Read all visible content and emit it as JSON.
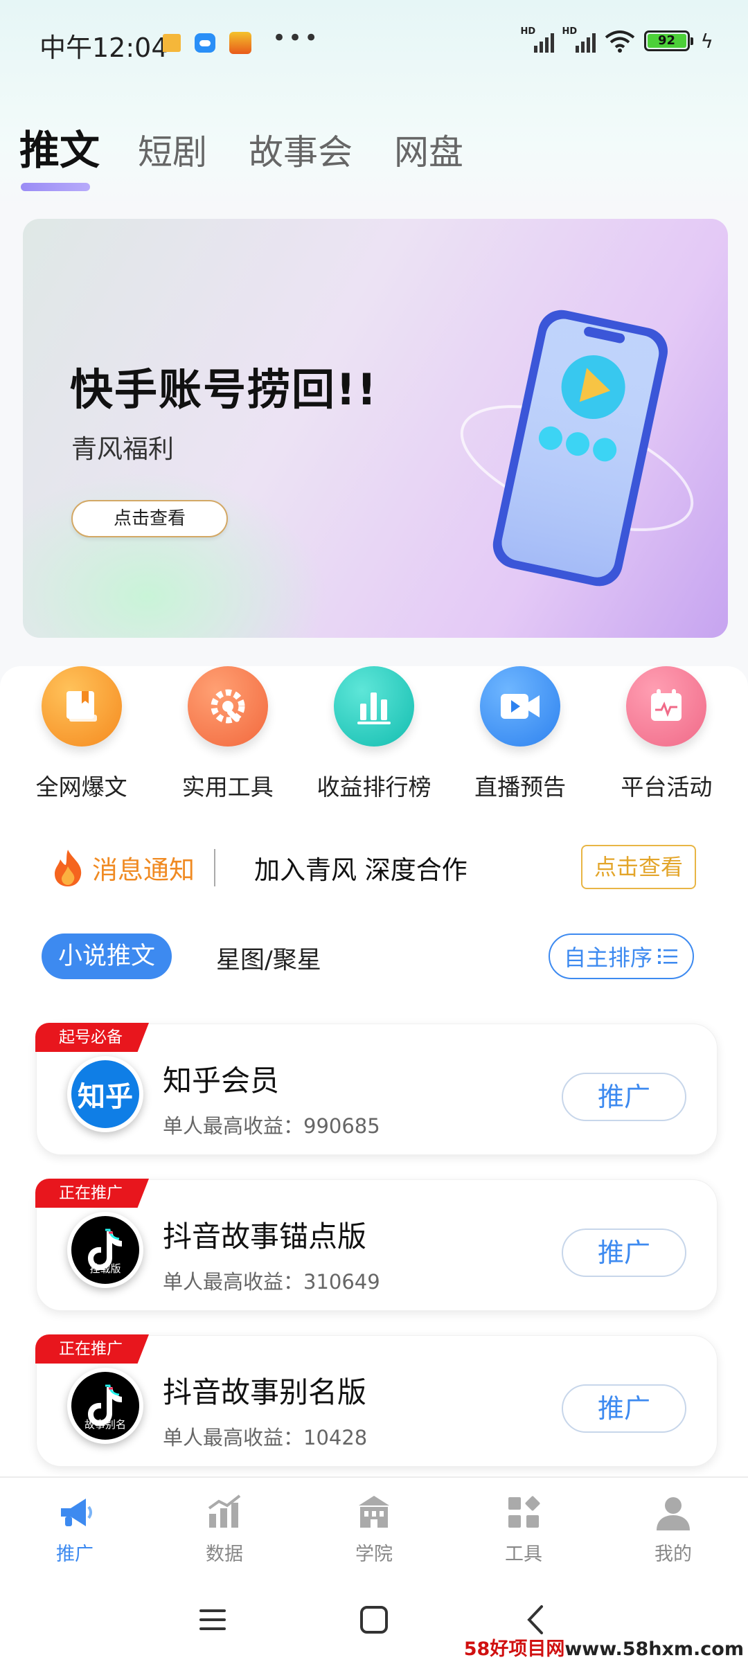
{
  "status_bar": {
    "time": "中午12:04",
    "battery": "92",
    "network_labels": [
      "HD",
      "HD"
    ]
  },
  "top_tabs": [
    "推文",
    "短剧",
    "故事会",
    "网盘"
  ],
  "banner": {
    "title": "快手账号捞回!!",
    "subtitle": "青风福利",
    "button": "点击查看"
  },
  "quick_actions": [
    {
      "label": "全网爆文",
      "icon": "book-icon"
    },
    {
      "label": "实用工具",
      "icon": "tools-icon"
    },
    {
      "label": "收益排行榜",
      "icon": "bar-chart-icon"
    },
    {
      "label": "直播预告",
      "icon": "video-camera-icon"
    },
    {
      "label": "平台活动",
      "icon": "calendar-icon"
    }
  ],
  "notice": {
    "title": "消息通知",
    "text": "加入青风 深度合作",
    "button": "点击查看"
  },
  "sub_tabs": {
    "active": "小说推文",
    "second": "星图/聚星",
    "sort": "自主排序"
  },
  "cards": [
    {
      "badge": "起号必备",
      "title": "知乎会员",
      "earning": "单人最高收益：990685",
      "logo_text": "知乎",
      "button": "推广"
    },
    {
      "badge": "正在推广",
      "title": "抖音故事锚点版",
      "earning": "单人最高收益：310649",
      "logo_text": "挂载版",
      "button": "推广"
    },
    {
      "badge": "正在推广",
      "title": "抖音故事别名版",
      "earning": "单人最高收益：10428",
      "logo_text": "故事别名",
      "button": "推广"
    }
  ],
  "bottom_nav": [
    {
      "label": "推广",
      "active": true
    },
    {
      "label": "数据",
      "active": false
    },
    {
      "label": "学院",
      "active": false
    },
    {
      "label": "工具",
      "active": false
    },
    {
      "label": "我的",
      "active": false
    }
  ],
  "watermark": {
    "red": "58好项目网",
    "black": "www.58hxm.com"
  },
  "colors": {
    "accent": "#3d8af0",
    "notice": "#f08a22",
    "ribbon": "#e8161d",
    "tab_underline": "#9a8cf5"
  }
}
